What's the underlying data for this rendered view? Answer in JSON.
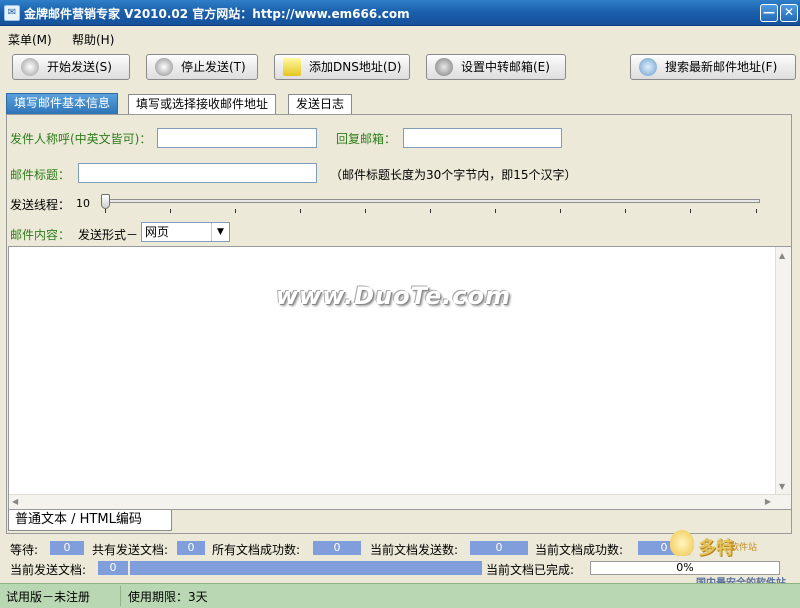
{
  "window": {
    "title": "金牌邮件营销专家 V2010.02  官方网站：http://www.em666.com",
    "app_icon_glyph": "✉",
    "minimize_glyph": "—",
    "close_glyph": "✕"
  },
  "menu": {
    "items": [
      "菜单(M)",
      "帮助(H)"
    ]
  },
  "toolbar": {
    "start": "开始发送(S)",
    "stop": "停止发送(T)",
    "add_dns": "添加DNS地址(D)",
    "relay": "设置中转邮箱(E)",
    "search": "搜索最新邮件地址(F)"
  },
  "tabs": [
    "填写邮件基本信息",
    "填写或选择接收邮件地址",
    "发送日志"
  ],
  "form": {
    "sender_label": "发件人称呼(中英文皆可)：",
    "sender_value": "",
    "reply_label": "回复邮箱：",
    "reply_value": "",
    "subject_label": "邮件标题：",
    "subject_value": "",
    "subject_hint": "（邮件标题长度为30个字节内，即15个汉字）",
    "threads_label": "发送线程：",
    "threads_value": "10",
    "content_label": "邮件内容：",
    "send_mode_label": "发送形式－",
    "send_mode_value": "网页"
  },
  "editor": {
    "watermark": "www.DuoTe.com",
    "mode_tab": "普通文本 / HTML编码",
    "arrow_up": "▲",
    "arrow_down": "▼",
    "arrow_left": "◀",
    "arrow_right": "▶"
  },
  "stats": {
    "waiting_label": "等待:",
    "waiting_value": "0",
    "total_docs_label": "共有发送文档:",
    "total_docs_value": "0",
    "all_success_label": "所有文档成功数:",
    "all_success_value": "0",
    "current_sent_label": "当前文档发送数:",
    "current_sent_value": "0",
    "current_success_label": "当前文档成功数:",
    "current_success_value": "0",
    "current_doc_label": "当前发送文档:",
    "current_doc_value": "0",
    "current_done_label": "当前文档已完成:",
    "current_done_value": "0%"
  },
  "statusbar": {
    "license": "试用版－未注册",
    "expiry_label": "使用期限：3天"
  },
  "logo": {
    "name": "多特",
    "sub": "软件站",
    "slogan": "国内最安全的软件站"
  },
  "colors": {
    "title_bar": "#1a5eaa",
    "accent_tab": "#2d75b8",
    "status_green": "#b9d7b2",
    "stat_fill": "#7f9edb",
    "label_green": "#2e7d1a"
  }
}
